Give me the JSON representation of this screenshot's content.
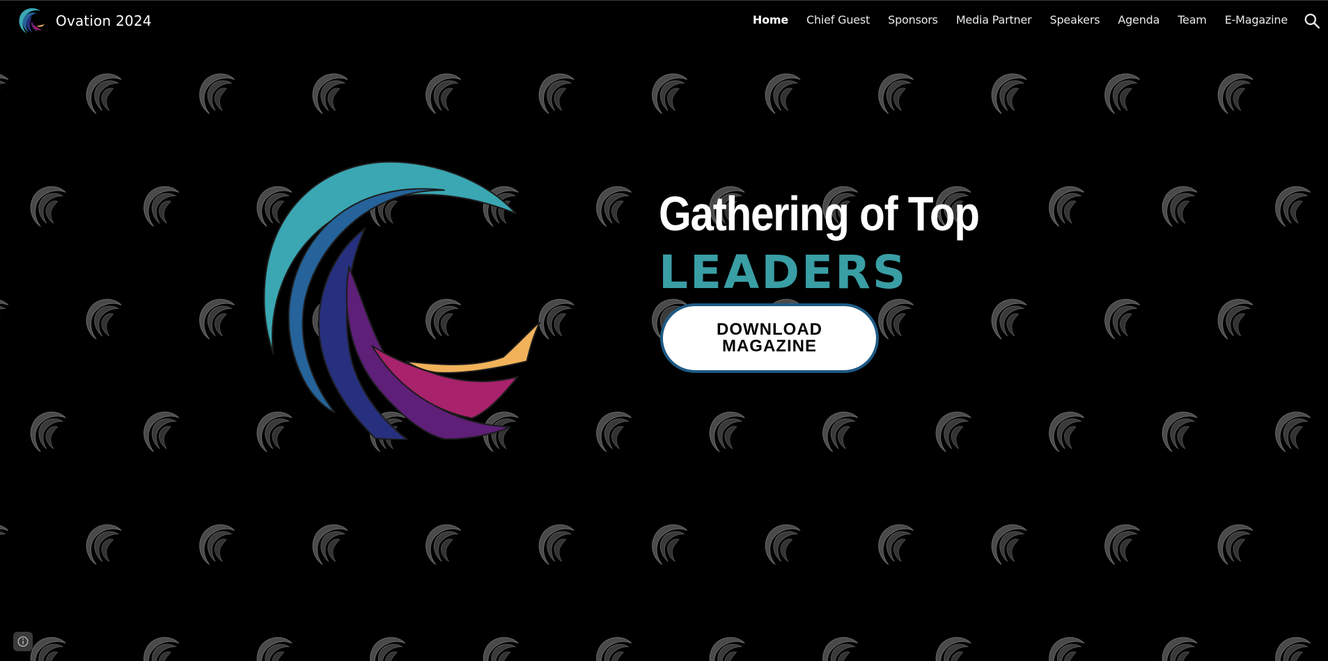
{
  "site": {
    "name": "Ovation 2024"
  },
  "nav": {
    "items": [
      {
        "label": "Home",
        "active": true
      },
      {
        "label": "Chief Guest"
      },
      {
        "label": "Sponsors"
      },
      {
        "label": "Media Partner"
      },
      {
        "label": "Speakers"
      },
      {
        "label": "Agenda"
      },
      {
        "label": "Team"
      },
      {
        "label": "E-Magazine"
      }
    ],
    "search_icon": "search-icon"
  },
  "hero": {
    "headline": "Gathering of Top",
    "accent": "LEADERS",
    "cta_label": "DOWNLOAD\nMAGAZINE"
  },
  "footer": {
    "info_icon": "info-icon"
  },
  "colors": {
    "background": "#000000",
    "accent_teal": "#3a9ea5",
    "cta_border": "#1e5a84",
    "logo_teal": "#3aa7b2",
    "logo_blue": "#25639a",
    "logo_navy": "#26307e",
    "logo_purple": "#5e1f78",
    "logo_magenta": "#a8226c",
    "logo_orange": "#f1b25a",
    "pattern_gray": "#2e2e2e"
  }
}
